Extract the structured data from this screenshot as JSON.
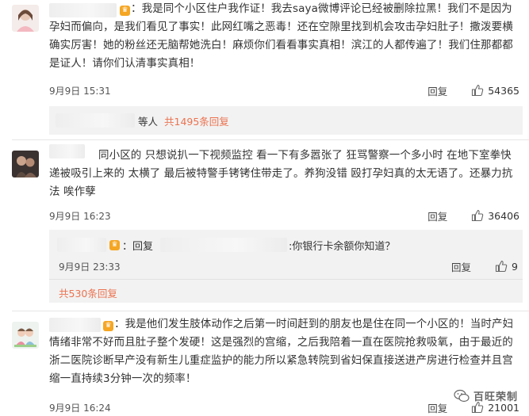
{
  "comments": [
    {
      "text_a": "：我是同个小区住户我作证！我去saya微博评论已经被删除拉黑！我们不是因为",
      "text_b": "孕妇而偏向，是我们看见了事实！此网红嘴之恶毒！还在空隙里找到机会攻击孕妇肚子！撒泼要横",
      "text_c": "确实厉害！她的粉丝还无脑帮她洗白！麻烦你们看看事实真相！滨江的人都传遍了！我们住那都都",
      "text_d": "是证人！请你们认清事实真相！",
      "date": "9月9日 15:31",
      "reply": "回复",
      "likes": "54365",
      "sub_others": "等人",
      "sub_more": "共1495条回复"
    },
    {
      "text_a": "同小区的 只想说扒一下视频监控 看一下有多嚣张了 狂骂警察一个多小时 在地下室拳快",
      "text_b": "递被吸引上来的 太横了 最后被特警手铐铐住带走了。养狗没错 殴打孕妇真的太无语了。还暴力抗",
      "text_c": "法 唉作孽",
      "date": "9月9日 16:23",
      "reply": "回复",
      "likes": "36406",
      "sub_reply_prefix": "：回复",
      "sub_reply_text": ":你银行卡余额你知道？",
      "sub_date": "9月9日 23:33",
      "sub_reply": "回复",
      "sub_likes": "9",
      "sub_more": "共530条回复"
    },
    {
      "text_a": "：我是他们发生肢体动作之后第一时间赶到的朋友也是住在同一个小区的！当时产妇",
      "text_b": "情绪非常不好而且肚子整个发硬！这是强烈的宫缩，之后我陪着一直在医院抢救吸氧，由于最近的",
      "text_c": "浙二医院诊断早产没有新生儿重症监护的能力所以紧急转院到省妇保直接送进产房进行检查并且宫",
      "text_d": "缩一直持续3分钟一次的频率！",
      "date": "9月9日 16:24",
      "reply": "回复",
      "likes": "21001"
    }
  ],
  "watermark": "百旺荣制",
  "icons": {
    "like": "thumbs-up-icon",
    "badge": "vip-badge-icon",
    "watermark": "wechat-icon"
  },
  "colors": {
    "link": "#eb7350",
    "badge": "#f5a623",
    "subbox": "#f2f2f2"
  }
}
